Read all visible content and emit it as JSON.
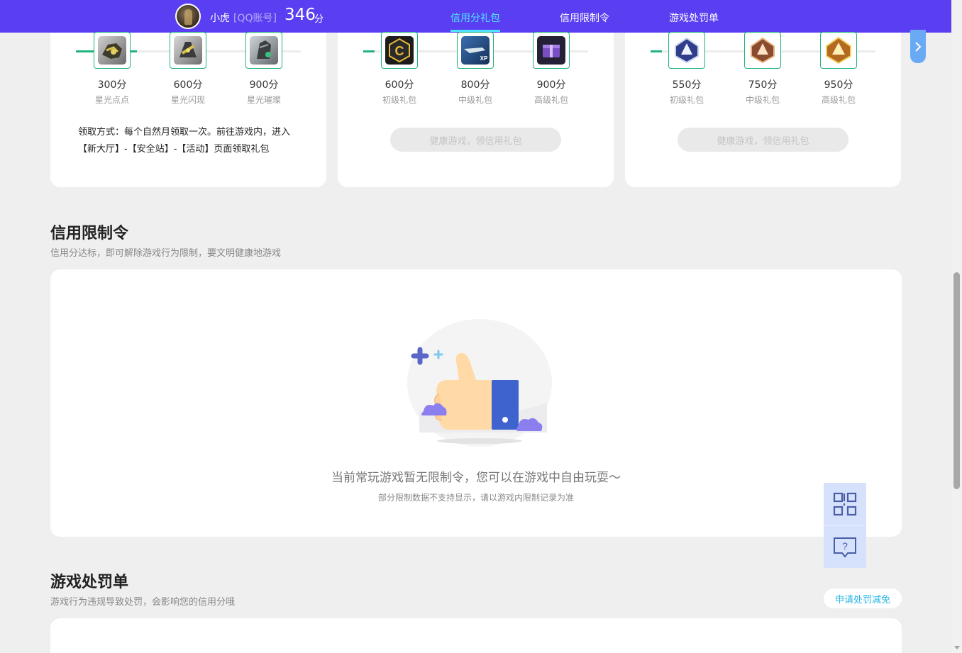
{
  "header": {
    "username": "小虎",
    "account_type": "[QQ账号]",
    "score": "346",
    "score_unit": "分",
    "tabs": [
      {
        "label": "信用分礼包",
        "active": true
      },
      {
        "label": "信用限制令",
        "active": false
      },
      {
        "label": "游戏处罚单",
        "active": false
      }
    ]
  },
  "gift_cards": [
    {
      "rewards": [
        {
          "points": "300分",
          "label": "星光点点"
        },
        {
          "points": "600分",
          "label": "星光闪现"
        },
        {
          "points": "900分",
          "label": "星光璀璨"
        }
      ],
      "note": "领取方式：每个自然月领取一次。前往游戏内，进入【新大厅】-【安全站】-【活动】页面领取礼包"
    },
    {
      "rewards": [
        {
          "points": "600分",
          "label": "初级礼包"
        },
        {
          "points": "800分",
          "label": "中级礼包"
        },
        {
          "points": "900分",
          "label": "高级礼包"
        }
      ],
      "button_label": "健康游戏，领信用礼包"
    },
    {
      "rewards": [
        {
          "points": "550分",
          "label": "初级礼包"
        },
        {
          "points": "750分",
          "label": "中级礼包"
        },
        {
          "points": "950分",
          "label": "高级礼包"
        }
      ],
      "button_label": "健康游戏，领信用礼包"
    }
  ],
  "restriction": {
    "title": "信用限制令",
    "subtitle": "信用分达标，即可解除游戏行为限制，要文明健康地游戏",
    "empty_main": "当前常玩游戏暂无限制令，您可以在游戏中自由玩耍～",
    "empty_sub": "部分限制数据不支持显示，请以游戏内限制记录为准"
  },
  "penalty": {
    "title": "游戏处罚单",
    "subtitle": "游戏行为违规导致处罚，会影响您的信用分哦",
    "apply_label": "申请处罚减免"
  },
  "colors": {
    "header_bg": "#5a3ff2",
    "active_tab": "#4fe3ff",
    "progress_green": "#21b37c",
    "page_bg": "#efefef"
  },
  "icons": [
    "qr-code-icon",
    "help-chat-icon",
    "chevron-right-icon",
    "thumbs-up-illustration"
  ]
}
